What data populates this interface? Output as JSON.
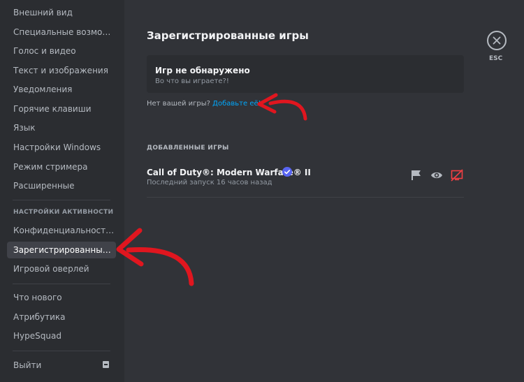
{
  "sidebar": {
    "items_top": [
      "Внешний вид",
      "Специальные возмож...",
      "Голос и видео",
      "Текст и изображения",
      "Уведомления",
      "Горячие клавиши",
      "Язык",
      "Настройки Windows",
      "Режим стримера",
      "Расширенные"
    ],
    "activity_header": "НАСТРОЙКИ АКТИВНОСТИ",
    "activity_items": [
      "Конфиденциальность ...",
      "Зарегистрированные ...",
      "Игровой оверлей"
    ],
    "misc_items": [
      "Что нового",
      "Атрибутика",
      "HypeSquad"
    ],
    "logout": "Выйти"
  },
  "main": {
    "title": "Зарегистрированные игры",
    "no_game_card": {
      "title": "Игр не обнаружено",
      "subtitle": "Во что вы играете?!"
    },
    "missing_prompt": "Нет вашей игры?",
    "add_link": "Добавьте её!",
    "added_header": "ДОБАВЛЕННЫЕ ИГРЫ",
    "game": {
      "name": "Call of Duty®: Modern Warfare® II",
      "last_played": "Последний запуск 16 часов назад"
    }
  },
  "close": {
    "label": "ESC"
  },
  "colors": {
    "background": "#313338",
    "sidebar": "#2b2d31",
    "link": "#00a8fc",
    "verified": "#5865f2",
    "overlay_off": "#f23f43",
    "annotation_arrow": "#e0161f"
  },
  "icons": [
    "logout-icon",
    "verified-icon",
    "flag-icon",
    "eye-icon",
    "overlay-off-icon",
    "close-icon"
  ]
}
